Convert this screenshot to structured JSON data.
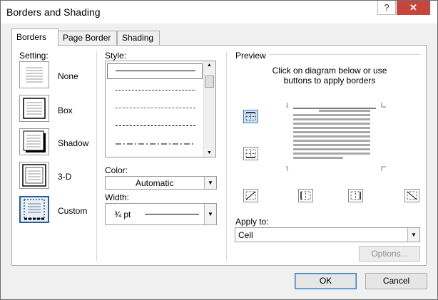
{
  "window": {
    "title": "Borders and Shading",
    "help_glyph": "?",
    "close_glyph": "✕"
  },
  "tabs": [
    {
      "label": "Borders",
      "active": true
    },
    {
      "label": "Page Border",
      "active": false
    },
    {
      "label": "Shading",
      "active": false
    }
  ],
  "setting": {
    "heading": "Setting:",
    "options": [
      {
        "label": "None",
        "selected": false
      },
      {
        "label": "Box",
        "selected": false
      },
      {
        "label": "Shadow",
        "selected": false
      },
      {
        "label": "3-D",
        "selected": false
      },
      {
        "label": "Custom",
        "selected": true
      }
    ]
  },
  "style": {
    "heading": "Style:"
  },
  "color": {
    "heading": "Color:",
    "value": "Automatic"
  },
  "width": {
    "heading": "Width:",
    "value": "¾ pt"
  },
  "preview": {
    "heading": "Preview",
    "instruction_line1": "Click on diagram below or use",
    "instruction_line2": "buttons to apply borders"
  },
  "apply_to": {
    "heading": "Apply to:",
    "value": "Cell"
  },
  "buttons": {
    "options": "Options...",
    "ok": "OK",
    "cancel": "Cancel"
  },
  "colors": {
    "accent": "#2a5d9a",
    "close_bg": "#c7463c",
    "dialog_bg": "#f0f0f0"
  }
}
